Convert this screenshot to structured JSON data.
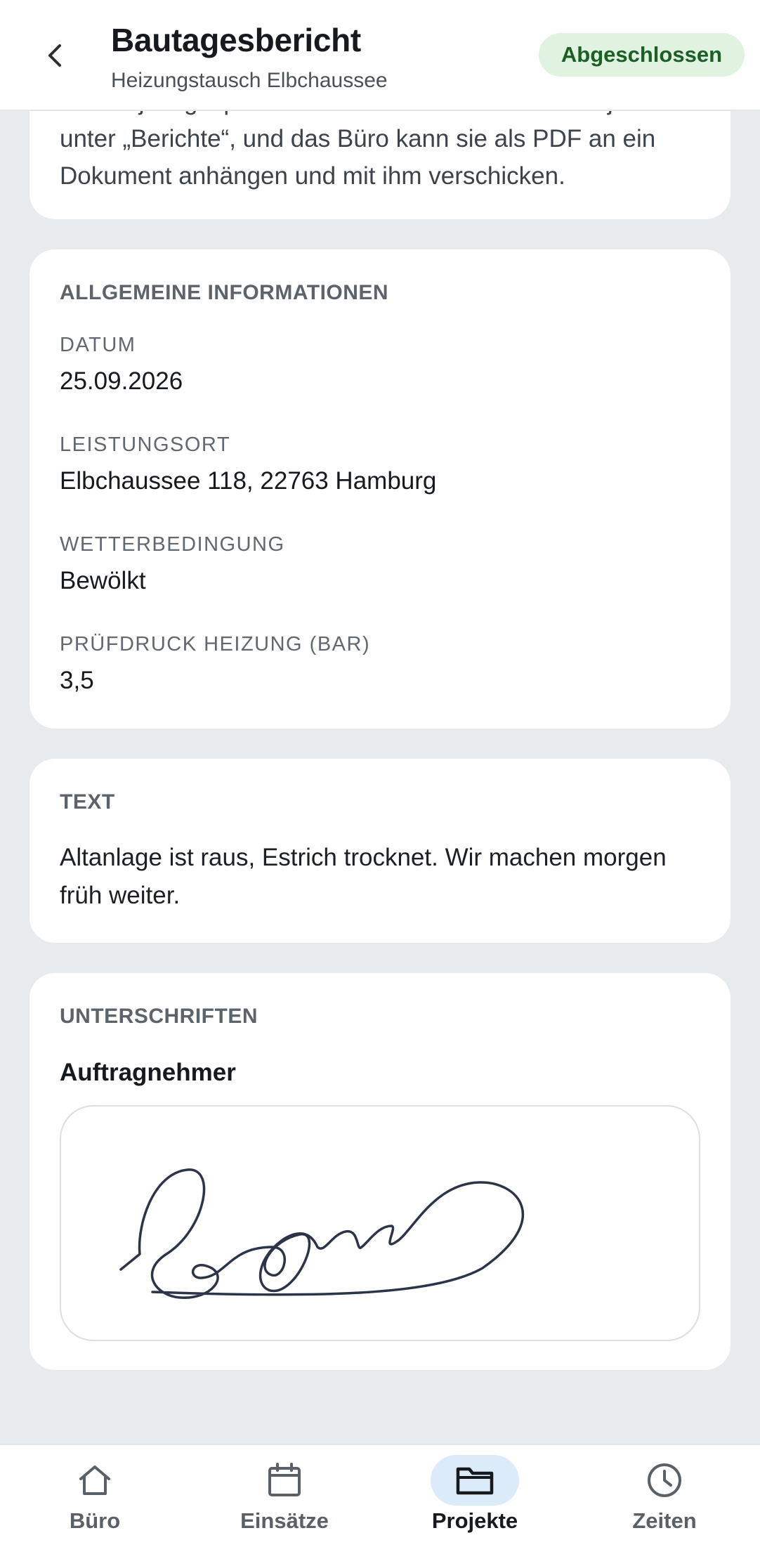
{
  "header": {
    "title": "Bautagesbericht",
    "subtitle": "Heizungstausch Elbchaussee",
    "status": "Abgeschlossen"
  },
  "intro": {
    "text": "am Projekt gespeichert. Im Büro stehen sie im Projekt unter „Berichte“, und das Büro kann sie als PDF an ein Dokument anhängen und mit ihm verschicken."
  },
  "general": {
    "title": "ALLGEMEINE INFORMATIONEN",
    "fields": [
      {
        "label": "DATUM",
        "value": "25.09.2026"
      },
      {
        "label": "LEISTUNGSORT",
        "value": "Elbchaussee 118, 22763 Hamburg"
      },
      {
        "label": "WETTERBEDINGUNG",
        "value": "Bewölkt"
      },
      {
        "label": "PRÜFDRUCK HEIZUNG (BAR)",
        "value": "3,5"
      }
    ]
  },
  "text_section": {
    "title": "TEXT",
    "body": "Altanlage ist raus, Estrich trocknet. Wir machen morgen früh weiter."
  },
  "signatures": {
    "title": "UNTERSCHRIFTEN",
    "signer": "Auftragnehmer"
  },
  "nav": {
    "items": [
      {
        "label": "Büro",
        "icon": "home-icon",
        "active": false
      },
      {
        "label": "Einsätze",
        "icon": "calendar-icon",
        "active": false
      },
      {
        "label": "Projekte",
        "icon": "folder-icon",
        "active": true
      },
      {
        "label": "Zeiten",
        "icon": "clock-icon",
        "active": false
      }
    ]
  },
  "colors": {
    "status_bg": "#dff3e0",
    "status_text": "#1c5e25",
    "nav_active_bg": "#dcebfa"
  }
}
